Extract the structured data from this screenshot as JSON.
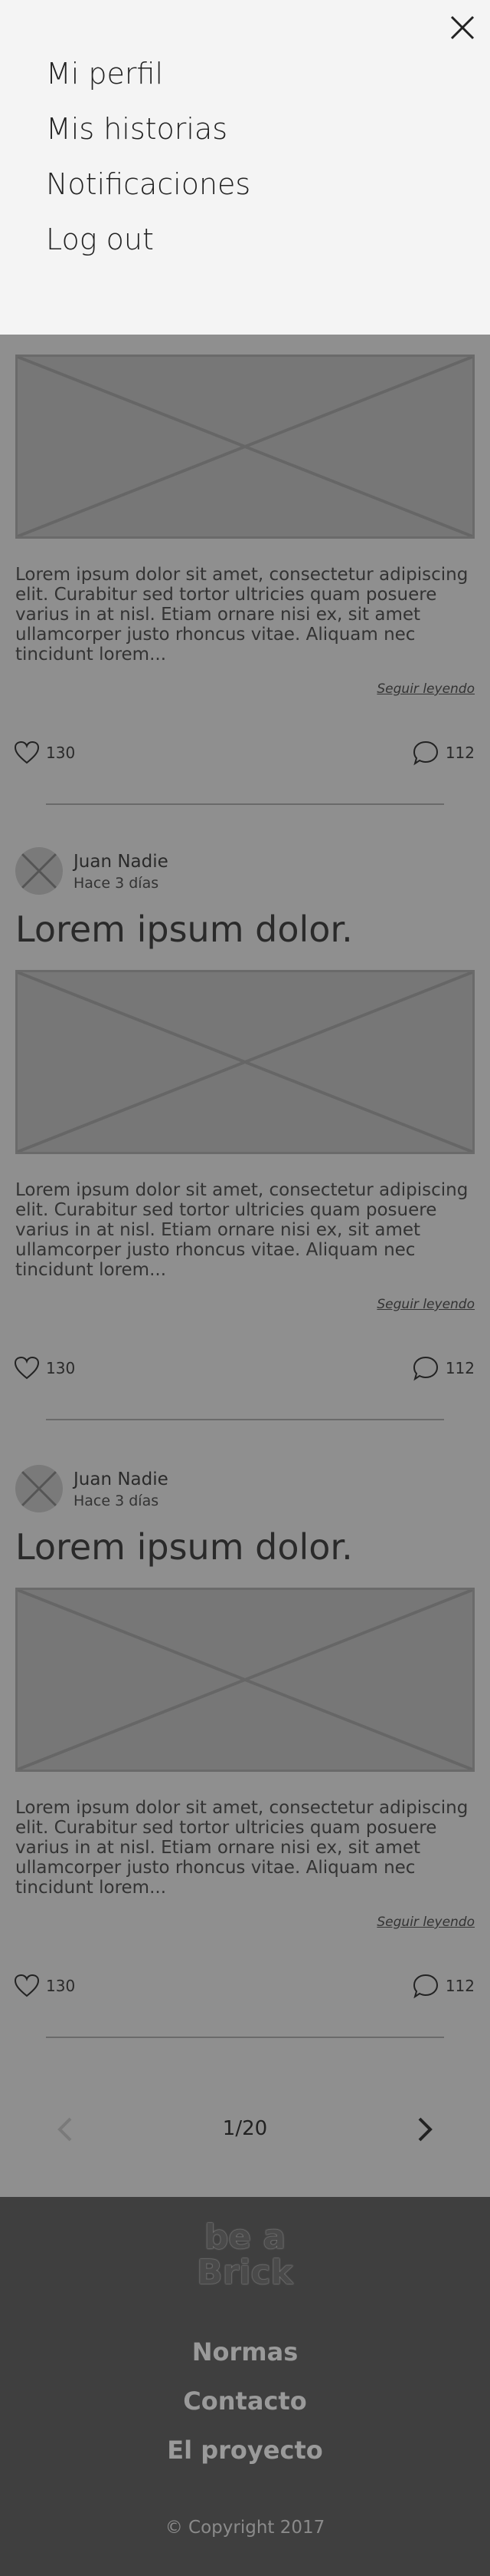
{
  "menu": {
    "items": [
      {
        "label": "Mi perfil"
      },
      {
        "label": "Mis historias"
      },
      {
        "label": "Notificaciones"
      },
      {
        "label": "Log out"
      }
    ]
  },
  "posts": [
    {
      "author": "",
      "time": "",
      "title": "",
      "excerpt": "Lorem ipsum dolor sit amet, consectetur adipiscing elit. Curabitur sed tortor ultricies quam posuere varius in at nisl. Etiam ornare nisi ex, sit amet ullamcorper justo rhoncus vitae. Aliquam nec tincidunt lorem...",
      "read_more": "Seguir leyendo",
      "likes": "130",
      "comments": "112"
    },
    {
      "author": "Juan Nadie",
      "time": "Hace 3 días",
      "title": "Lorem ipsum dolor.",
      "excerpt": "Lorem ipsum dolor sit amet, consectetur adipiscing elit. Curabitur sed tortor ultricies quam posuere varius in at nisl. Etiam ornare nisi ex, sit amet ullamcorper justo rhoncus vitae. Aliquam nec tincidunt lorem...",
      "read_more": "Seguir leyendo",
      "likes": "130",
      "comments": "112"
    },
    {
      "author": "Juan Nadie",
      "time": "Hace 3 días",
      "title": "Lorem ipsum dolor.",
      "excerpt": "Lorem ipsum dolor sit amet, consectetur adipiscing elit. Curabitur sed tortor ultricies quam posuere varius in at nisl. Etiam ornare nisi ex, sit amet ullamcorper justo rhoncus vitae. Aliquam nec tincidunt lorem...",
      "read_more": "Seguir leyendo",
      "likes": "130",
      "comments": "112"
    }
  ],
  "pagination": {
    "label": "1/20"
  },
  "footer": {
    "logo_line1": "be a",
    "logo_line2": "Brick",
    "links": [
      {
        "label": "Normas"
      },
      {
        "label": "Contacto"
      },
      {
        "label": "El proyecto"
      }
    ],
    "copyright": "© Copyright 2017"
  },
  "icons": {
    "close": "close-icon",
    "like": "heart-icon",
    "comment": "speech-bubble-icon",
    "prev": "chevron-left-icon",
    "next": "chevron-right-icon"
  },
  "colors": {
    "menu_bg": "#f4f4f4",
    "feed_bg": "#8f8f8f",
    "footer_bg": "#3f3f3f"
  }
}
